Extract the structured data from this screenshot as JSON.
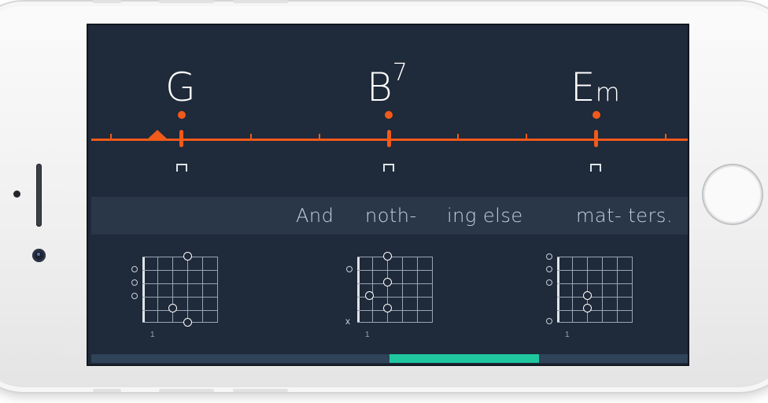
{
  "chords": [
    {
      "root": "G",
      "sup": "",
      "suffix": ""
    },
    {
      "root": "B",
      "sup": "7",
      "suffix": ""
    },
    {
      "root": "E",
      "sup": "",
      "suffix": "m"
    }
  ],
  "lyrics": [
    "And",
    "noth-",
    "ing else",
    "mat- ters."
  ],
  "diagrams": [
    {
      "chord": "G",
      "fret_label": "1",
      "string_markers": [
        "",
        "",
        "",
        "o",
        "o",
        "o"
      ]
    },
    {
      "chord": "B7",
      "fret_label": "1",
      "string_markers": [
        "x",
        "",
        "",
        "o",
        "",
        ""
      ]
    },
    {
      "chord": "Em",
      "fret_label": "1",
      "string_markers": [
        "o",
        "",
        "",
        "o",
        "o",
        "o"
      ]
    }
  ],
  "playback": {
    "progress_start": 0.5,
    "progress_end": 0.75
  },
  "colors": {
    "accent": "#f05a1a",
    "background": "#1f2a3a",
    "lyric_band": "#2a3749",
    "progress": "#1fc79f"
  }
}
